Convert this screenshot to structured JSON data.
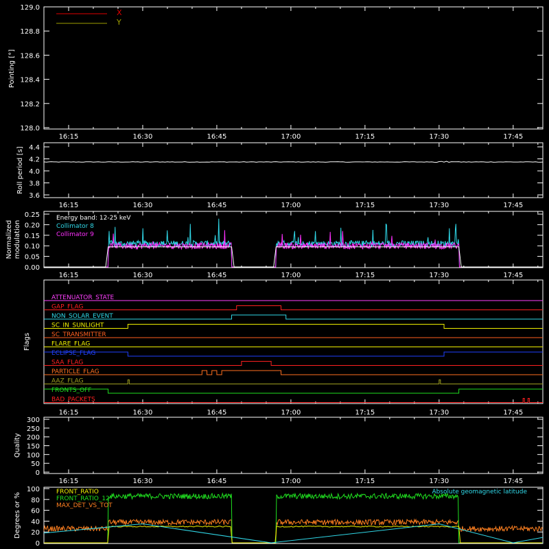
{
  "panels": {
    "pointing": {
      "ylabel": "Pointing [°]",
      "yticks": [
        "128.0",
        "128.2",
        "128.4",
        "128.6",
        "128.8",
        "129.0"
      ],
      "legend": [
        {
          "name": "X",
          "color": "#e00000"
        },
        {
          "name": "Y",
          "color": "#a0a000"
        }
      ]
    },
    "roll": {
      "ylabel": "Roll period [s]",
      "yticks": [
        "3.6",
        "3.8",
        "4.0",
        "4.2",
        "4.4"
      ]
    },
    "modulation": {
      "ylabel_line1": "Normalized",
      "ylabel_line2": "modulation",
      "yticks": [
        "0.00",
        "0.05",
        "0.10",
        "0.15",
        "0.20",
        "0.25"
      ],
      "legend": [
        {
          "name": "Energy band: 12-25 keV",
          "color": "#ffffff"
        },
        {
          "name": "Collimator 8",
          "color": "#30d8e8"
        },
        {
          "name": "Collimator 9",
          "color": "#ff30ff"
        }
      ]
    },
    "flags": {
      "ylabel": "Flags",
      "rows": [
        {
          "name": "ATTENUATOR_STATE",
          "color": "#ff40ff"
        },
        {
          "name": "GAP_FLAG",
          "color": "#ff2020"
        },
        {
          "name": "NON_SOLAR_EVENT",
          "color": "#30d8e8"
        },
        {
          "name": "SC_IN_SUNLIGHT",
          "color": "#f0f000"
        },
        {
          "name": "SC_TRANSMITTER",
          "color": "#ff6020"
        },
        {
          "name": "FLARE_FLAG",
          "color": "#f0f000"
        },
        {
          "name": "ECLIPSE_FLAG",
          "color": "#2040ff"
        },
        {
          "name": "SAA_FLAG",
          "color": "#ff2020"
        },
        {
          "name": "PARTICLE_FLAG",
          "color": "#ff7020"
        },
        {
          "name": "AAZ_FLAG",
          "color": "#a0a020"
        },
        {
          "name": "FRONTS_OFF",
          "color": "#20e020"
        },
        {
          "name": "BAD_PACKETS",
          "color": "#ff2020"
        }
      ]
    },
    "quality": {
      "ylabel": "Quality",
      "yticks": [
        "0",
        "50",
        "100",
        "150",
        "200",
        "250",
        "300"
      ]
    },
    "ratios": {
      "ylabel": "Degrees or %",
      "yticks": [
        "0",
        "20",
        "40",
        "60",
        "80",
        "100"
      ],
      "legend": [
        {
          "name": "FRONT_RATIO",
          "color": "#f0f000"
        },
        {
          "name": "FRONT_RATIO_12",
          "color": "#20e020"
        },
        {
          "name": "MAX_DET_VS_TOT",
          "color": "#ff8020"
        }
      ],
      "right_label": "Absolute geomagnetic latitude",
      "right_label_color": "#30d8e8"
    }
  },
  "xticks": [
    "16:15",
    "16:30",
    "16:45",
    "17:00",
    "17:15",
    "17:30",
    "17:45"
  ],
  "chart_data": {
    "type": "line",
    "x_range": [
      "16:10",
      "17:51"
    ],
    "xticks": [
      "16:15",
      "16:30",
      "16:45",
      "17:00",
      "17:15",
      "17:30",
      "17:45"
    ],
    "panels": [
      {
        "name": "pointing",
        "ylim": [
          128.0,
          129.0
        ],
        "series": [
          {
            "name": "X",
            "values": []
          },
          {
            "name": "Y",
            "values": []
          }
        ]
      },
      {
        "name": "roll",
        "ylim": [
          3.5,
          4.5
        ],
        "series": [
          {
            "name": "roll",
            "x": [
              "16:10",
              "16:30",
              "17:00",
              "17:30",
              "17:51"
            ],
            "values": [
              4.15,
              4.15,
              4.15,
              4.16,
              4.15
            ]
          }
        ]
      },
      {
        "name": "modulation",
        "ylim": [
          0,
          0.25
        ],
        "active_intervals": [
          [
            "16:23",
            "16:48"
          ],
          [
            "16:57",
            "17:34"
          ]
        ],
        "series": [
          {
            "name": "Collimator 8",
            "typical": 0.11,
            "max": 0.22
          },
          {
            "name": "Collimator 9",
            "typical": 0.1,
            "max": 0.19
          }
        ]
      },
      {
        "name": "flags",
        "intervals": {
          "GAP_FLAG": [
            [
              "16:49",
              "16:58"
            ]
          ],
          "NON_SOLAR_EVENT": [
            [
              "16:48",
              "16:59"
            ]
          ],
          "SC_IN_SUNLIGHT": [
            [
              "16:27",
              "17:31"
            ]
          ],
          "ECLIPSE_FLAG_low": [
            [
              "16:27",
              "17:31"
            ]
          ],
          "SAA_FLAG": [
            [
              "16:50",
              "16:56"
            ]
          ],
          "PARTICLE_FLAG": [
            [
              "16:42",
              "16:43"
            ],
            [
              "16:44",
              "16:45"
            ],
            [
              "16:46",
              "16:58"
            ]
          ],
          "AAZ_FLAG": [
            [
              "16:27",
              "16:27"
            ],
            [
              "17:30",
              "17:30"
            ]
          ],
          "FRONTS_OFF_low": [
            [
              "16:23",
              "17:34"
            ]
          ],
          "BAD_PACKETS": [
            [
              "17:47",
              "17:47"
            ],
            [
              "17:48",
              "17:48"
            ]
          ]
        }
      },
      {
        "name": "quality",
        "ylim": [
          0,
          300
        ],
        "series": [
          {
            "name": "quality",
            "value": 0
          }
        ]
      },
      {
        "name": "ratios",
        "ylim": [
          0,
          100
        ],
        "series": [
          {
            "name": "FRONT_RATIO",
            "x": [
              "16:23",
              "16:48",
              "16:57",
              "17:34"
            ],
            "values": [
              30,
              30,
              32,
              30
            ]
          },
          {
            "name": "FRONT_RATIO_12",
            "x": [
              "16:23",
              "16:48",
              "16:57",
              "17:34"
            ],
            "values": [
              85,
              87,
              88,
              85
            ]
          },
          {
            "name": "MAX_DET_VS_TOT",
            "x": [
              "16:10",
              "16:23",
              "16:48",
              "16:57",
              "17:34",
              "17:51"
            ],
            "values": [
              25,
              38,
              38,
              38,
              38,
              25
            ]
          },
          {
            "name": "Absolute geomagnetic latitude",
            "x": [
              "16:10",
              "16:30",
              "16:56",
              "17:30",
              "17:45",
              "17:51"
            ],
            "values": [
              18,
              35,
              0,
              35,
              0,
              10
            ]
          }
        ]
      }
    ]
  }
}
